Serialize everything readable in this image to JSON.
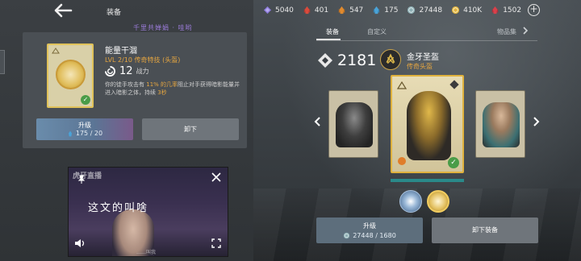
{
  "header": {
    "title": "装备",
    "stream_banner": "千里共婵娟 · 哇哟"
  },
  "currencies": [
    {
      "icon": "purple-gem-icon",
      "value": "5040",
      "color": "#8b7ad8"
    },
    {
      "icon": "red-crystal-icon",
      "value": "401",
      "color": "#d94a3c"
    },
    {
      "icon": "orange-crystal-icon",
      "value": "547",
      "color": "#e08a2e"
    },
    {
      "icon": "blue-crystal-icon",
      "value": "175",
      "color": "#4aa3d8"
    },
    {
      "icon": "silver-coin-icon",
      "value": "27448",
      "color": "#8fb0b5"
    },
    {
      "icon": "gold-coin-icon",
      "value": "410K",
      "color": "#e0b23e"
    },
    {
      "icon": "red-gem-icon",
      "value": "1502",
      "color": "#d9404a"
    }
  ],
  "detail": {
    "name": "能量干涸",
    "level_line": "LVL  2/10  传奇特技 (头盔)",
    "power_value": "12",
    "power_label": "战力",
    "desc_pre": "你的徒手攻击有 ",
    "desc_hl1": "11% 的几率",
    "desc_mid": "阻止对手获得暗影能量并进入暗影之体，持续 ",
    "desc_hl2": "3秒",
    "upgrade_label": "升级",
    "upgrade_cost": "175 / 20",
    "unequip_label": "卸下"
  },
  "video": {
    "watermark": "虎牙直播",
    "subtitle": "这文的叫啥",
    "caption": "……叫我"
  },
  "tabs": [
    {
      "label": "装备",
      "active": true
    },
    {
      "label": "自定义",
      "active": false
    },
    {
      "label": "物品集",
      "active": false
    }
  ],
  "item": {
    "gear_score": "2181",
    "name": "金牙圣盔",
    "type": "传奇头盔"
  },
  "actions": {
    "upgrade_label": "升级",
    "upgrade_cost": "27448 / 1680",
    "unequip_label": "卸下装备"
  }
}
